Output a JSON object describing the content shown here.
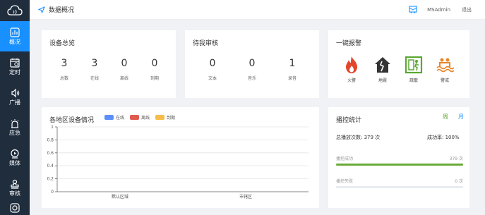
{
  "nav": {
    "items": [
      {
        "label": "概况",
        "icon": "overview-icon",
        "active": true
      },
      {
        "label": "定时",
        "icon": "schedule-icon"
      },
      {
        "label": "广播",
        "icon": "broadcast-icon"
      },
      {
        "label": "应急",
        "icon": "emergency-icon"
      },
      {
        "label": "媒体",
        "icon": "media-icon"
      },
      {
        "label": "审核",
        "icon": "review-icon"
      }
    ]
  },
  "header": {
    "breadcrumb": "数据概况",
    "user": "MSAdmin",
    "logout": "退出"
  },
  "device_overview": {
    "title": "设备总览",
    "stats": [
      {
        "value": "3",
        "label": "总数"
      },
      {
        "value": "3",
        "label": "在线"
      },
      {
        "value": "0",
        "label": "离线"
      },
      {
        "value": "0",
        "label": "到期"
      }
    ]
  },
  "pending_review": {
    "title": "待我审核",
    "stats": [
      {
        "value": "0",
        "label": "文本"
      },
      {
        "value": "0",
        "label": "音乐"
      },
      {
        "value": "1",
        "label": "录音"
      }
    ]
  },
  "alarm": {
    "title": "一键报警",
    "items": [
      {
        "label": "火警",
        "icon": "fire-icon",
        "color": "#e2452b"
      },
      {
        "label": "地震",
        "icon": "earthquake-icon",
        "color": "#333333"
      },
      {
        "label": "疏散",
        "icon": "evacuate-icon",
        "color": "#5aa832"
      },
      {
        "label": "警戒",
        "icon": "flood-icon",
        "color": "#e8862a"
      }
    ]
  },
  "region_chart": {
    "title": "各地区设备情况",
    "chart_data": {
      "type": "bar",
      "categories": [
        "默认区域",
        "市辖区"
      ],
      "series": [
        {
          "name": "在线",
          "color": "#5b8ff9",
          "values": [
            0,
            0
          ]
        },
        {
          "name": "离线",
          "color": "#e05a4f",
          "values": [
            0,
            0
          ]
        },
        {
          "name": "到期",
          "color": "#f6bd4a",
          "values": [
            0,
            0
          ]
        }
      ],
      "y_ticks": [
        "0",
        "0.2",
        "0.4",
        "0.6",
        "0.8",
        "1"
      ],
      "ylim": [
        0,
        1
      ],
      "grid": true,
      "legend": "top-center"
    }
  },
  "broadcast_stats": {
    "title": "播控统计",
    "tabs": [
      "周",
      "月"
    ],
    "total_label": "总播放次数: 379 次",
    "success_rate_label": "成功率: 100%",
    "success": {
      "label": "播控成功",
      "value": "379 次",
      "fraction": 1.0
    },
    "failure": {
      "label": "播控失败",
      "value": "0 次",
      "fraction": 0.0
    }
  }
}
